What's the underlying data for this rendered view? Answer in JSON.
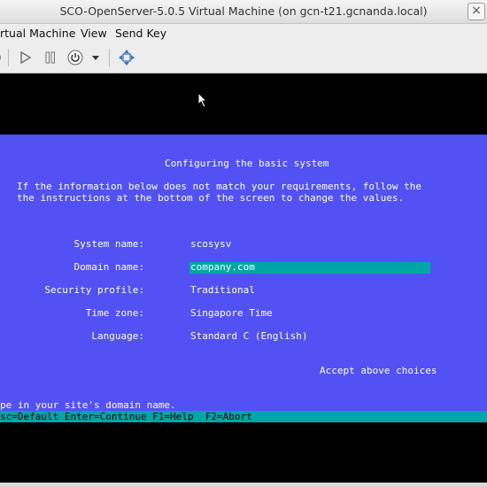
{
  "window": {
    "title": "SCO-OpenServer-5.0.5 Virtual Machine (on gcn-t21.gcnanda.local)",
    "close_glyph": "×"
  },
  "menu": {
    "items": [
      "rtual Machine",
      "View",
      "Send Key"
    ]
  },
  "toolbar": {
    "icons": [
      "run-icon",
      "pause-icon",
      "power-icon",
      "dropdown-arrow-icon",
      "fullscreen-icon"
    ]
  },
  "screen": {
    "heading": "Configuring the basic system",
    "intro_line1": "If the information below does not match your requirements, follow the",
    "intro_line2": "the instructions at the bottom of the screen to change the values.",
    "fields": [
      {
        "label": "System name:",
        "value": "scosysv"
      },
      {
        "label": "Domain name:",
        "value": "company.com"
      },
      {
        "label": "Security profile:",
        "value": "Traditional"
      },
      {
        "label": "Time zone:",
        "value": "Singapore Time"
      },
      {
        "label": "Language:",
        "value": "Standard C (English)"
      }
    ],
    "accept": "Accept above choices",
    "hint": "pe in your site's domain name.",
    "keys": "sc=Default Enter=Continue F1=Help  F2=Abort"
  },
  "colors": {
    "panel": "#5151f4",
    "highlight": "#00a5a5",
    "console_bg": "#000000"
  }
}
